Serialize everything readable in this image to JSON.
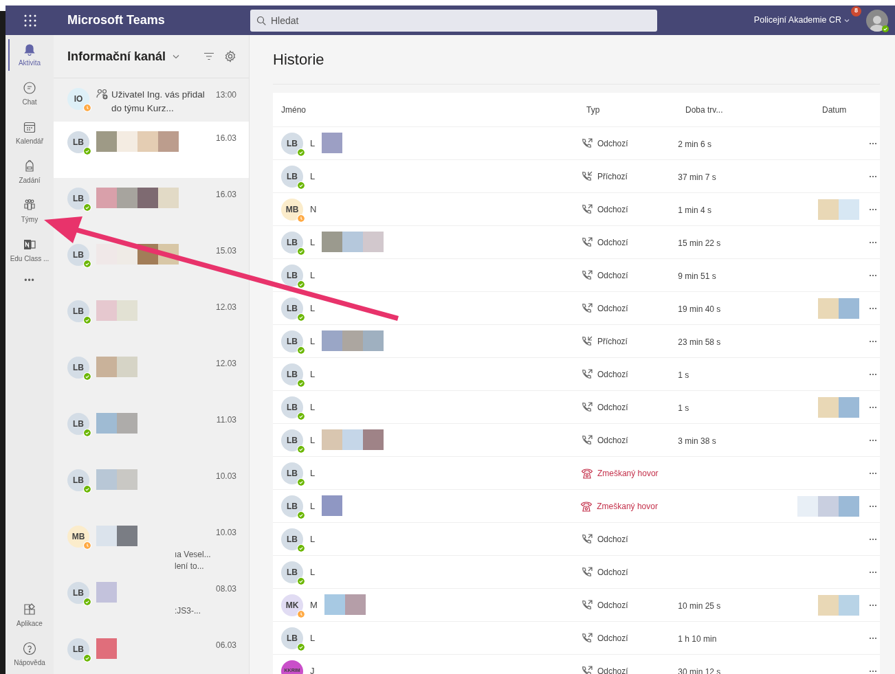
{
  "top_bar": {
    "app_name": "Microsoft Teams",
    "search": {
      "placeholder": "Hledat"
    },
    "org": "Policejní Akademie CR",
    "notification_count": "8",
    "profile": {
      "available": true
    }
  },
  "rail": {
    "items": [
      {
        "label": "Aktivita",
        "kind": "bell",
        "selected": true
      },
      {
        "label": "Chat",
        "kind": "chat",
        "selected": false
      },
      {
        "label": "Kalendář",
        "kind": "calendar",
        "selected": false
      },
      {
        "label": "Zadání",
        "kind": "backpack",
        "selected": false
      },
      {
        "label": "Týmy",
        "kind": "teams",
        "selected": false
      },
      {
        "label": "Edu Class ...",
        "kind": "notebook",
        "selected": false
      }
    ],
    "more": "•••",
    "bottom_items": [
      {
        "label": "Aplikace",
        "kind": "apps"
      },
      {
        "label": "Nápověda",
        "kind": "help"
      }
    ]
  },
  "feed": {
    "title": "Informační kanál",
    "items": [
      {
        "initials": "IO",
        "away": true,
        "color": "#def0f7",
        "time": "13:00",
        "text": "Uživatel Ing. vás přidal do týmu Kurz...",
        "selected": false
      },
      {
        "initials": "LB",
        "away": false,
        "color": "#d4dde6",
        "time": "16.03",
        "selected": true
      },
      {
        "initials": "LB",
        "away": false,
        "color": "#d4dde6",
        "time": "16.03",
        "selected": false
      },
      {
        "initials": "LB",
        "away": false,
        "color": "#d4dde6",
        "time": "15.03",
        "selected": false
      },
      {
        "initials": "LB",
        "away": false,
        "color": "#d4dde6",
        "time": "12.03",
        "selected": false
      },
      {
        "initials": "LB",
        "away": false,
        "color": "#d4dde6",
        "time": "12.03",
        "selected": false
      },
      {
        "initials": "LB",
        "away": false,
        "color": "#d4dde6",
        "time": "11.03",
        "selected": false
      },
      {
        "initials": "LB",
        "away": false,
        "color": "#d4dde6",
        "time": "10.03",
        "selected": false
      },
      {
        "initials": "MB",
        "away": true,
        "color": "#fbeccb",
        "time": "10.03",
        "text": "ıa Vesel... lení to...",
        "selected": false
      },
      {
        "initials": "LB",
        "away": false,
        "color": "#d4dde6",
        "time": "08.03",
        "text": ":JS3-...",
        "selected": false
      },
      {
        "initials": "LB",
        "away": false,
        "color": "#d4dde6",
        "time": "06.03",
        "selected": false
      }
    ]
  },
  "history": {
    "title": "Historie",
    "columns": [
      "Jméno",
      "Typ",
      "Doba trv...",
      "Datum"
    ],
    "rows": [
      {
        "initials": "LB",
        "color": "#d4dde6",
        "away": false,
        "name": "L",
        "kind": "outgoing",
        "type": "Odchozí",
        "duration": "2 min 6 s"
      },
      {
        "initials": "LB",
        "color": "#d4dde6",
        "away": false,
        "name": "L",
        "kind": "incoming",
        "type": "Příchozí",
        "duration": "37 min 7 s"
      },
      {
        "initials": "MB",
        "color": "#fbeccb",
        "away": true,
        "name": "N",
        "kind": "outgoing",
        "type": "Odchozí",
        "duration": "1 min 4 s"
      },
      {
        "initials": "LB",
        "color": "#d4dde6",
        "away": false,
        "name": "L",
        "kind": "outgoing",
        "type": "Odchozí",
        "duration": "15 min 22 s"
      },
      {
        "initials": "LB",
        "color": "#d4dde6",
        "away": false,
        "name": "L",
        "kind": "outgoing",
        "type": "Odchozí",
        "duration": "9 min 51 s"
      },
      {
        "initials": "LB",
        "color": "#d4dde6",
        "away": false,
        "name": "L",
        "kind": "outgoing",
        "type": "Odchozí",
        "duration": "19 min 40 s"
      },
      {
        "initials": "LB",
        "color": "#d4dde6",
        "away": false,
        "name": "L",
        "kind": "incoming",
        "type": "Příchozí",
        "duration": "23 min 58 s"
      },
      {
        "initials": "LB",
        "color": "#d4dde6",
        "away": false,
        "name": "L",
        "kind": "outgoing",
        "type": "Odchozí",
        "duration": "1 s"
      },
      {
        "initials": "LB",
        "color": "#d4dde6",
        "away": false,
        "name": "L",
        "kind": "outgoing",
        "type": "Odchozí",
        "duration": "1 s"
      },
      {
        "initials": "LB",
        "color": "#d4dde6",
        "away": false,
        "name": "L",
        "kind": "outgoing",
        "type": "Odchozí",
        "duration": "3 min 38 s"
      },
      {
        "initials": "LB",
        "color": "#d4dde6",
        "away": false,
        "name": "L",
        "kind": "missed",
        "type": "Zmeškaný hovor"
      },
      {
        "initials": "LB",
        "color": "#d4dde6",
        "away": false,
        "name": "L",
        "kind": "missed",
        "type": "Zmeškaný hovor"
      },
      {
        "initials": "LB",
        "color": "#d4dde6",
        "away": false,
        "name": "L",
        "kind": "outgoing",
        "type": "Odchozí"
      },
      {
        "initials": "LB",
        "color": "#d4dde6",
        "away": false,
        "name": "L",
        "kind": "outgoing",
        "type": "Odchozí"
      },
      {
        "initials": "MK",
        "color": "#e1dcf3",
        "away": true,
        "name": "M",
        "kind": "outgoing",
        "type": "Odchozí",
        "duration": "10 min 25 s"
      },
      {
        "initials": "LB",
        "color": "#d4dde6",
        "away": false,
        "name": "L",
        "kind": "outgoing",
        "type": "Odchozí",
        "duration": "1 h 10 min"
      },
      {
        "initials": "KKRIM",
        "color": "#c94fc9",
        "name": "J",
        "kind": "outgoing",
        "type": "Odchozí",
        "duration": "30 min 12 s"
      }
    ]
  }
}
